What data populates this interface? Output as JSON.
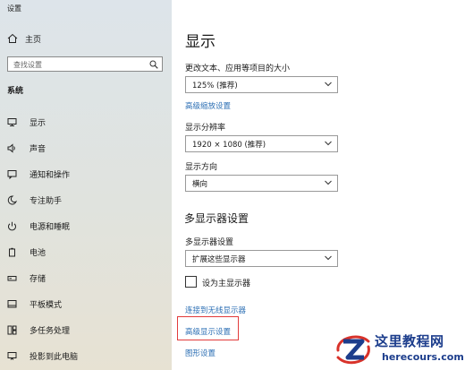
{
  "window": {
    "title": "设置"
  },
  "sidebar": {
    "home_label": "主页",
    "search_placeholder": "查找设置",
    "section_title": "系统",
    "items": [
      {
        "label": "显示",
        "icon": "monitor-icon"
      },
      {
        "label": "声音",
        "icon": "speaker-icon"
      },
      {
        "label": "通知和操作",
        "icon": "notification-icon"
      },
      {
        "label": "专注助手",
        "icon": "moon-icon"
      },
      {
        "label": "电源和睡眠",
        "icon": "power-icon"
      },
      {
        "label": "电池",
        "icon": "battery-icon"
      },
      {
        "label": "存储",
        "icon": "storage-icon"
      },
      {
        "label": "平板模式",
        "icon": "tablet-icon"
      },
      {
        "label": "多任务处理",
        "icon": "multitask-icon"
      },
      {
        "label": "投影到此电脑",
        "icon": "project-icon"
      }
    ]
  },
  "main": {
    "title": "显示",
    "scale": {
      "label": "更改文本、应用等项目的大小",
      "value": "125% (推荐)",
      "link": "高级缩放设置"
    },
    "resolution": {
      "label": "显示分辨率",
      "value": "1920 × 1080 (推荐)"
    },
    "orientation": {
      "label": "显示方向",
      "value": "横向"
    },
    "multi": {
      "heading": "多显示器设置",
      "label": "多显示器设置",
      "value": "扩展这些显示器",
      "checkbox_label": "设为主显示器",
      "checked": false,
      "link_connect": "连接到无线显示器",
      "link_advanced": "高级显示设置",
      "link_graphics": "图形设置"
    }
  },
  "watermark": {
    "title": "这里教程网",
    "url": "herecours.com",
    "accent": "#1c3d8c"
  },
  "colors": {
    "link": "#2c6fb4",
    "highlight": "#e23b3b"
  }
}
